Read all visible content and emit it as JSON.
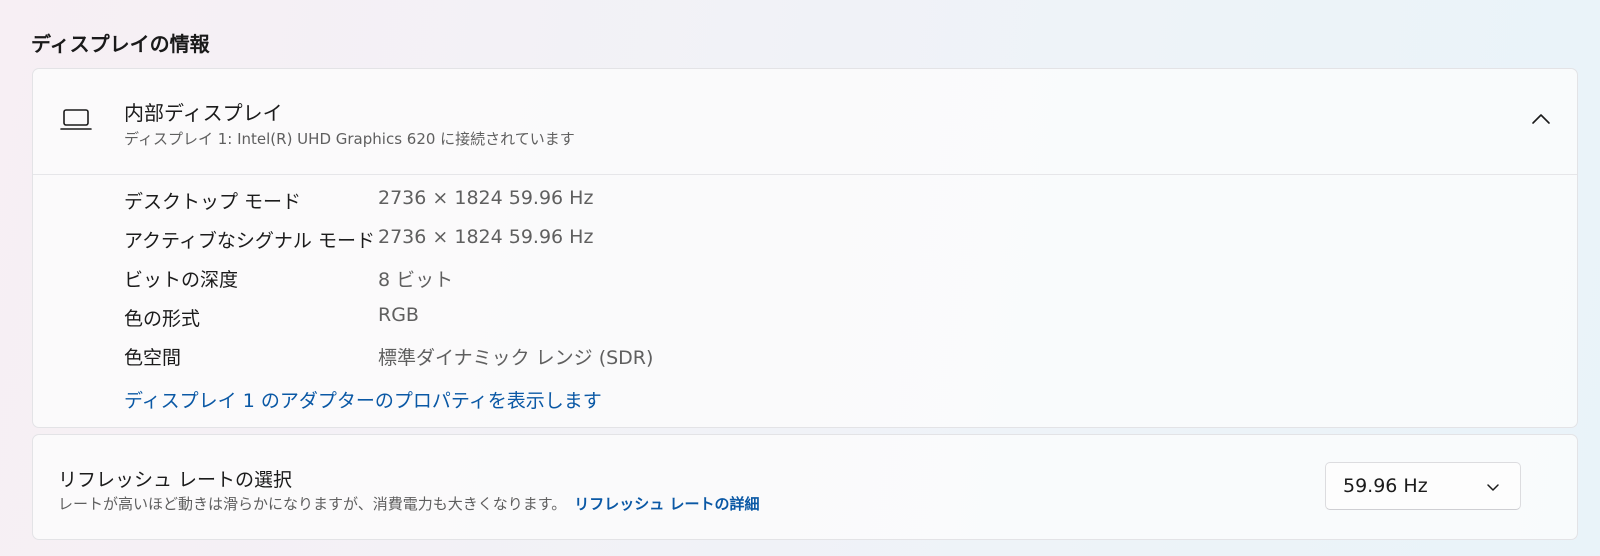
{
  "section": {
    "title": "ディスプレイの情報"
  },
  "display": {
    "title": "内部ディスプレイ",
    "subtitle": "ディスプレイ 1: Intel(R) UHD Graphics 620 に接続されています",
    "icon": "laptop-icon",
    "collapse_icon": "chevron-up-icon",
    "rows": [
      {
        "label": "デスクトップ モード",
        "value": "2736 × 1824 59.96 Hz"
      },
      {
        "label": "アクティブなシグナル モード",
        "value": "2736 × 1824 59.96 Hz"
      },
      {
        "label": "ビットの深度",
        "value": "8 ビット"
      },
      {
        "label": "色の形式",
        "value": "RGB"
      },
      {
        "label": "色空間",
        "value": "標準ダイナミック レンジ (SDR)"
      }
    ],
    "adapter_link": "ディスプレイ 1 のアダプターのプロパティを表示します"
  },
  "refresh": {
    "title": "リフレッシュ レートの選択",
    "description": "レートが高いほど動きは滑らかになりますが、消費電力も大きくなります。",
    "link": "リフレッシュ レートの詳細",
    "selected": "59.96 Hz",
    "dropdown_icon": "chevron-down-icon"
  },
  "colors": {
    "accent_link": "#0a58a5",
    "secondary_text": "#5f5f5f"
  }
}
